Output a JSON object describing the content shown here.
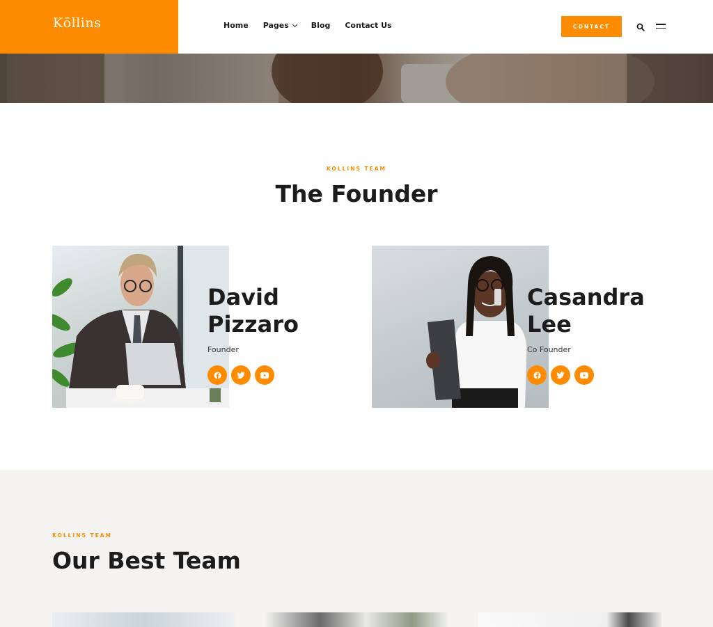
{
  "brand": {
    "logo_text": "Kōllins",
    "accent_color": "#ff8c00"
  },
  "nav": {
    "items": [
      {
        "label": "Home",
        "has_dropdown": false
      },
      {
        "label": "Pages",
        "has_dropdown": true
      },
      {
        "label": "Blog",
        "has_dropdown": false
      },
      {
        "label": "Contact Us",
        "has_dropdown": false
      }
    ],
    "contact_button": "CONTACT",
    "search_icon": "search-icon",
    "menu_icon": "hamburger-menu-icon"
  },
  "founders_section": {
    "eyebrow": "KOLLINS TEAM",
    "title": "The Founder",
    "founders": [
      {
        "name_line1": "David",
        "name_line2": "Pizzaro",
        "role": "Founder",
        "socials": [
          "facebook-icon",
          "twitter-icon",
          "youtube-icon"
        ]
      },
      {
        "name_line1": "Casandra",
        "name_line2": "Lee",
        "role": "Co Founder",
        "socials": [
          "facebook-icon",
          "twitter-icon",
          "youtube-icon"
        ]
      }
    ]
  },
  "team_section": {
    "eyebrow": "KOLLINS TEAM",
    "title": "Our Best Team",
    "background_color": "#f6f4f2"
  }
}
